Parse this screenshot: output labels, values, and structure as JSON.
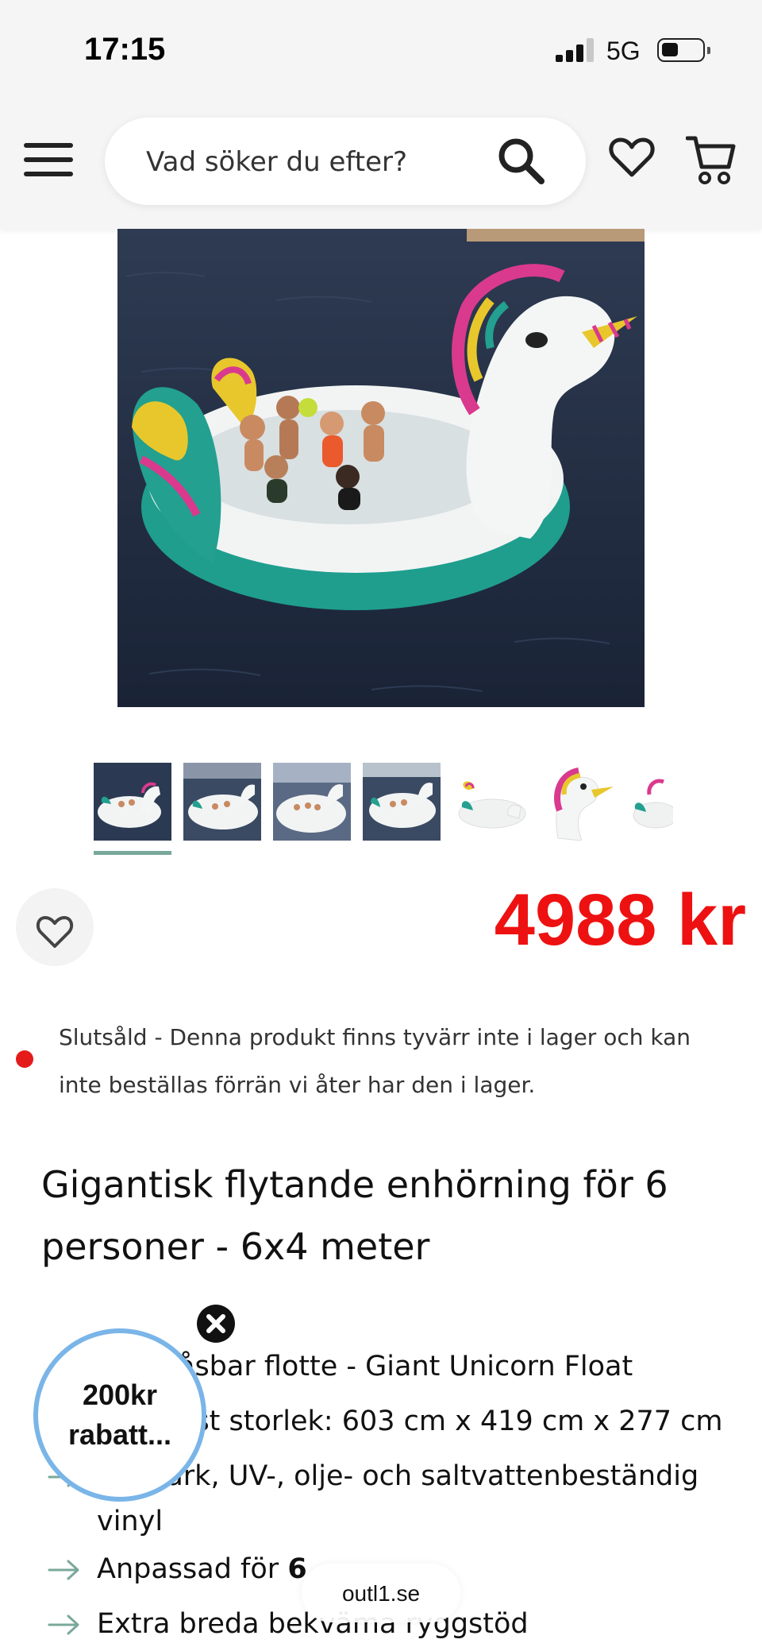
{
  "status_bar": {
    "time": "17:15",
    "network": "5G"
  },
  "header": {
    "search_placeholder": "Vad söker du efter?"
  },
  "product": {
    "price": "4988 kr",
    "stock_notice": "Slutsåld - Denna produkt finns tyvärr inte i lager och kan inte beställas förrän vi åter har den i lager.",
    "title": "Gigantisk flytande enhörning för 6 personer - 6x4 meter",
    "features": [
      {
        "text": "Uppblåsbar flotte - Giant Unicorn Float"
      },
      {
        "text": "Uppblåst storlek: 603 cm x 419 cm x 277 cm"
      },
      {
        "text": "Slitstark, UV-, olje- och saltvattenbeständig",
        "text_cont": "vinyl"
      },
      {
        "text_pre": "Anpassad för ",
        "text_bold": "6"
      },
      {
        "text": "Extra breda bekväma ryggstöd"
      }
    ],
    "thumbnail_count": 7
  },
  "promo": {
    "discount_label": "200kr rabatt..."
  },
  "browser": {
    "url": "outl1.se"
  },
  "colors": {
    "price": "#ee1111",
    "stock_dot": "#e51a1a",
    "thumb_active": "#7aa89b",
    "badge_border": "#7ab5e8",
    "arrow": "#7aa89b"
  }
}
